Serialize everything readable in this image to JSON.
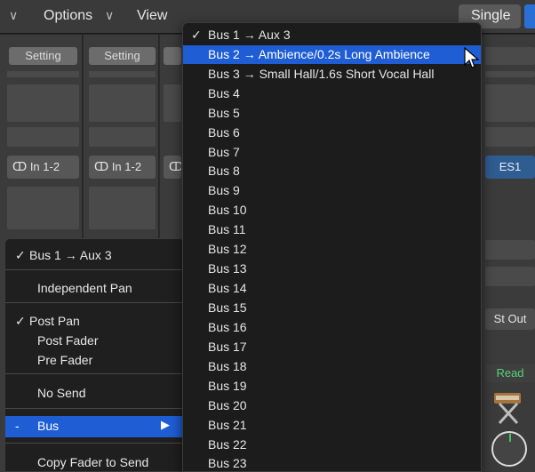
{
  "topbar": {
    "options_label": "Options",
    "view_label": "View",
    "single_label": "Single",
    "chevron": "∨"
  },
  "strips": {
    "setting_label": "Setting",
    "input_label": "In 1-2",
    "stereo_icon": "stereo-link-icon"
  },
  "right_strip": {
    "instrument_label": "ES1",
    "output_label": "St Out",
    "automation_label": "Read"
  },
  "context_menu": {
    "items": [
      {
        "label": "Bus 1 → Aux 3",
        "checked": true
      },
      {
        "label": "Independent Pan",
        "checked": false
      },
      {
        "label": "Post Pan",
        "checked": true
      },
      {
        "label": "Post Fader",
        "checked": false
      },
      {
        "label": "Pre Fader",
        "checked": false
      },
      {
        "label": "No Send",
        "checked": false
      },
      {
        "label": "Bus",
        "prefix": "-",
        "highlighted": true,
        "submenu_arrow": "▶"
      },
      {
        "label": "Copy Fader to Send",
        "checked": false
      }
    ]
  },
  "bus_menu": {
    "check_mark": "✓",
    "items": [
      {
        "label": "Bus 1 → Aux 3",
        "checked": true
      },
      {
        "label": "Bus 2 → Ambience/0.2s Long Ambience",
        "highlighted": true
      },
      {
        "label": "Bus 3 → Small Hall/1.6s Short Vocal Hall"
      },
      {
        "label": "Bus 4"
      },
      {
        "label": "Bus 5"
      },
      {
        "label": "Bus 6"
      },
      {
        "label": "Bus 7"
      },
      {
        "label": "Bus 8"
      },
      {
        "label": "Bus 9"
      },
      {
        "label": "Bus 10"
      },
      {
        "label": "Bus 11"
      },
      {
        "label": "Bus 12"
      },
      {
        "label": "Bus 13"
      },
      {
        "label": "Bus 14"
      },
      {
        "label": "Bus 15"
      },
      {
        "label": "Bus 16"
      },
      {
        "label": "Bus 17"
      },
      {
        "label": "Bus 18"
      },
      {
        "label": "Bus 19"
      },
      {
        "label": "Bus 20"
      },
      {
        "label": "Bus 21"
      },
      {
        "label": "Bus 22"
      },
      {
        "label": "Bus 23"
      }
    ]
  },
  "colors": {
    "highlight": "#1f5dd4",
    "read_green": "#57d07a",
    "instrument_blue": "#2f5c91"
  }
}
